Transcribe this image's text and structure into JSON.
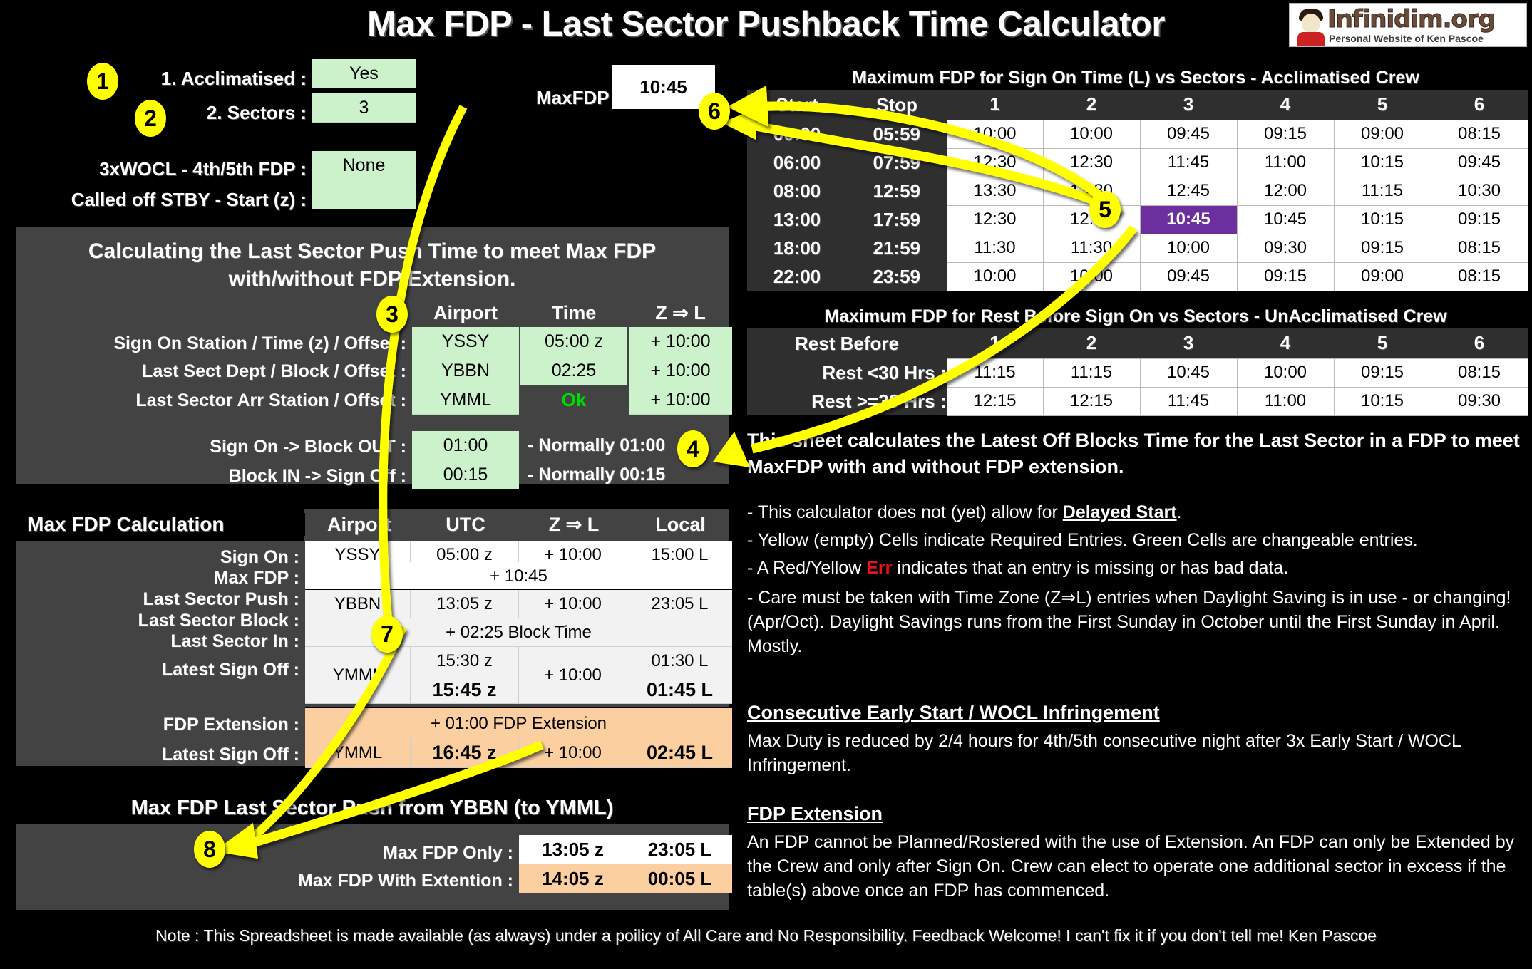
{
  "title": "Max FDP - Last Sector Pushback Time Calculator",
  "logo": {
    "wordmark": "Infinidim.org",
    "subtitle": "Personal Website of Ken Pascoe"
  },
  "inputs": {
    "acclimatised_label": "1. Acclimatised :",
    "acclimatised_value": "Yes",
    "sectors_label": "2. Sectors :",
    "sectors_value": "3",
    "wocl_label": "3xWOCL - 4th/5th FDP :",
    "wocl_value": "None",
    "stby_label": "Called off STBY - Start (z) :",
    "stby_value": "",
    "maxfdp_label": "MaxFDP :",
    "maxfdp_value": "10:45"
  },
  "callouts": [
    "1",
    "2",
    "3",
    "4",
    "5",
    "6",
    "7",
    "8"
  ],
  "acclimatised_table": {
    "title": "Maximum FDP for Sign On Time (L) vs Sectors - Acclimatised Crew",
    "col_start": "Start",
    "col_stop": "Stop",
    "sector_headers": [
      "1",
      "2",
      "3",
      "4",
      "5",
      "6"
    ],
    "rows": [
      {
        "start": "00:00",
        "stop": "05:59",
        "values": [
          "10:00",
          "10:00",
          "09:45",
          "09:15",
          "09:00",
          "08:15"
        ]
      },
      {
        "start": "06:00",
        "stop": "07:59",
        "values": [
          "12:30",
          "12:30",
          "11:45",
          "11:00",
          "10:15",
          "09:45"
        ]
      },
      {
        "start": "08:00",
        "stop": "12:59",
        "values": [
          "13:30",
          "13:30",
          "12:45",
          "12:00",
          "11:15",
          "10:30"
        ]
      },
      {
        "start": "13:00",
        "stop": "17:59",
        "values": [
          "12:30",
          "12:30",
          "10:45",
          "10:45",
          "10:15",
          "09:15"
        ]
      },
      {
        "start": "18:00",
        "stop": "21:59",
        "values": [
          "11:30",
          "11:30",
          "10:00",
          "09:30",
          "09:15",
          "08:15"
        ]
      },
      {
        "start": "22:00",
        "stop": "23:59",
        "values": [
          "10:00",
          "10:00",
          "09:45",
          "09:15",
          "09:00",
          "08:15"
        ]
      }
    ],
    "highlight": {
      "row": 3,
      "col": 2
    },
    "highlight_color": "#6b2f9e"
  },
  "unacclimatised_table": {
    "title": "Maximum FDP for Rest Before Sign On vs Sectors - UnAcclimatised Crew",
    "col_rest": "Rest Before",
    "sector_headers": [
      "1",
      "2",
      "3",
      "4",
      "5",
      "6"
    ],
    "rows": [
      {
        "label": "Rest <30 Hrs :",
        "values": [
          "11:15",
          "11:15",
          "10:45",
          "10:00",
          "09:15",
          "08:15"
        ]
      },
      {
        "label": "Rest >=30 Hrs :",
        "values": [
          "12:15",
          "12:15",
          "11:45",
          "11:00",
          "10:15",
          "09:30"
        ]
      }
    ]
  },
  "mid_panel": {
    "heading_line1": "Calculating the Last Sector Push Time to meet Max FDP",
    "heading_line2": "with/without FDP Extension.",
    "col_airport": "Airport",
    "col_time": "Time",
    "col_zl": "Z ⇒ L",
    "rows": [
      {
        "label": "Sign On Station / Time (z) / Offset :",
        "airport": "YSSY",
        "time": "05:00 z",
        "zl": "+ 10:00"
      },
      {
        "label": "Last Sect Dept / Block / Offset :",
        "airport": "YBBN",
        "time": "02:25",
        "zl": "+ 10:00"
      },
      {
        "label": "Last Sector Arr Station / Offset :",
        "airport": "YMML",
        "time": "Ok",
        "zl": "+ 10:00"
      }
    ],
    "ok_color": "#00dd00",
    "extra": [
      {
        "label": "Sign On -> Block OUT :",
        "value": "01:00",
        "note": "- Normally 01:00"
      },
      {
        "label": "Block IN -> Sign Off :",
        "value": "00:15",
        "note": "- Normally 00:15"
      }
    ]
  },
  "calc_table": {
    "title": "Max FDP Calculation",
    "headers": [
      "Airport",
      "UTC",
      "Z ⇒ L",
      "Local"
    ],
    "rows": [
      {
        "label": "Sign On :",
        "airport": "YSSY",
        "utc": "05:00 z",
        "zl": "+ 10:00",
        "local": "15:00 L",
        "style": "white"
      },
      {
        "label": "Max FDP :",
        "span": "+ 10:45",
        "style": "white-span"
      },
      {
        "label": "Last Sector Push :",
        "airport": "YBBN",
        "utc": "13:05 z",
        "zl": "+ 10:00",
        "local": "23:05 L",
        "style": "grey"
      },
      {
        "label": "Last Sector Block :",
        "span": "+ 02:25 Block Time",
        "style": "grey-span"
      },
      {
        "label": "Last Sector In :",
        "airport": "YMML",
        "utc": "15:30 z",
        "zl": "+ 10:00",
        "local": "01:30 L",
        "style": "grey"
      },
      {
        "label": "Latest Sign Off :",
        "airport": "",
        "utc": "15:45 z",
        "zl": "",
        "local": "01:45 L",
        "style": "grey-bold"
      },
      {
        "label": "FDP Extension :",
        "span": "+ 01:00 FDP Extension",
        "style": "orange-span"
      },
      {
        "label": "Latest Sign Off :",
        "airport": "YMML",
        "utc": "16:45 z",
        "zl": "+ 10:00",
        "local": "02:45 L",
        "style": "orange-bold"
      }
    ]
  },
  "push_table": {
    "title": "Max FDP Last Sector Push from YBBN (to YMML)",
    "rows": [
      {
        "label": "Max FDP Only :",
        "utc": "13:05 z",
        "local": "23:05 L",
        "style": "white"
      },
      {
        "label": "Max FDP With Extention :",
        "utc": "14:05 z",
        "local": "00:05 L",
        "style": "orange"
      }
    ]
  },
  "notes": {
    "intro": "This sheet calculates the Latest Off Blocks Time for the Last Sector in a FDP to meet MaxFDP with and without FDP extension.",
    "b1_pre": " - This calculator does not (yet) allow for ",
    "b1_em": "Delayed Start",
    "b1_post": ".",
    "b2": " - Yellow (empty) Cells indicate Required Entries. Green Cells are changeable entries.",
    "b3_pre": "- A Red/Yellow ",
    "b3_err": "Err",
    "b3_post": " indicates that an entry is missing or has bad data.",
    "b4": " - Care must be taken with Time Zone (Z⇒L) entries when Daylight Saving is in use - or changing! (Apr/Oct). Daylight Savings runs from the First Sunday in October until the First Sunday in April. Mostly.",
    "h1": "Consecutive Early Start / WOCL Infringement",
    "p1": "Max Duty is reduced by 2/4 hours for 4th/5th consecutive night after 3x Early Start / WOCL Infringement.",
    "h2": "FDP Extension",
    "p2": "An FDP cannot be Planned/Rostered with the use of Extension. An FDP can only be Extended by the Crew and only after Sign On. Crew can elect to operate one additional sector in excess if the table(s) above once an FDP has commenced."
  },
  "footer": "Note : This Spreadsheet is made available (as always) under a poilicy of All Care and No Responsibility. Feedback Welcome! I can't fix it if you don't tell me! Ken Pascoe"
}
